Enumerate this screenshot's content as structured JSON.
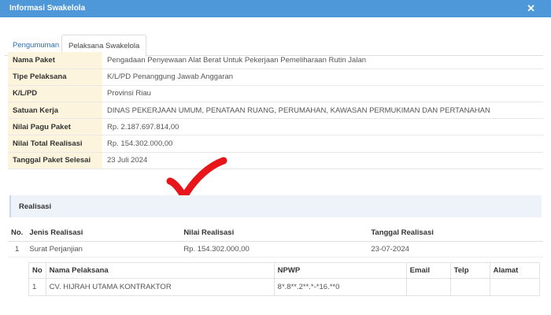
{
  "window": {
    "title": "Informasi Swakelola",
    "close_glyph": "✕"
  },
  "tabs": [
    {
      "label": "Pengumuman"
    },
    {
      "label": "Pelaksana Swakelola"
    }
  ],
  "detail": [
    {
      "label": "Nama Paket",
      "value": "Pengadaan Penyewaan Alat Berat Untuk Pekerjaan Pemeliharaan Rutin Jalan"
    },
    {
      "label": "Tipe Pelaksana",
      "value": "K/L/PD Penanggung Jawab Anggaran"
    },
    {
      "label": "K/L/PD",
      "value": "Provinsi Riau"
    },
    {
      "label": "Satuan Kerja",
      "value": "DINAS PEKERJAAN UMUM, PENATAAN RUANG, PERUMAHAN, KAWASAN PERMUKIMAN DAN PERTANAHAN"
    },
    {
      "label": "Nilai Pagu Paket",
      "value": "Rp. 2.187.697.814,00"
    },
    {
      "label": "Nilai Total Realisasi",
      "value": "Rp. 154.302.000,00"
    },
    {
      "label": "Tanggal Paket Selesai",
      "value": "23 Juli 2024"
    }
  ],
  "annotation": {
    "icon": "checkmark-icon",
    "color": "#e8151b"
  },
  "realisasi": {
    "section_title": "Realisasi",
    "headers": {
      "no": "No.",
      "jenis": "Jenis Realisasi",
      "nilai": "Nilai Realisasi",
      "tanggal": "Tanggal Realisasi"
    },
    "rows": [
      {
        "no": "1",
        "jenis": "Surat Perjanjian",
        "nilai": "Rp. 154.302.000,00",
        "tanggal": "23-07-2024"
      }
    ]
  },
  "pelaksana": {
    "headers": {
      "no": "No",
      "nama": "Nama Pelaksana",
      "npwp": "NPWP",
      "email": "Email",
      "telp": "Telp",
      "alamat": "Alamat"
    },
    "rows": [
      {
        "no": "1",
        "nama": "CV. HIJRAH UTAMA KONTRAKTOR",
        "npwp": "8*.8**.2**.*-*16.**0",
        "email": "",
        "telp": "",
        "alamat": ""
      }
    ]
  }
}
